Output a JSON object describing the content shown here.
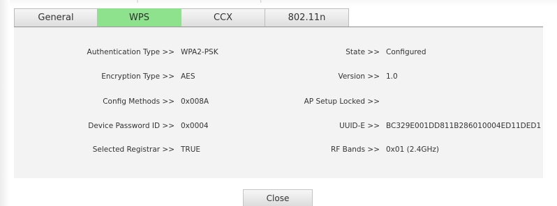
{
  "header_partial": "(",
  "header_partial2": ")",
  "tabs": [
    {
      "label": "General",
      "active": false
    },
    {
      "label": "WPS",
      "active": true
    },
    {
      "label": "CCX",
      "active": false
    },
    {
      "label": "802.11n",
      "active": false
    }
  ],
  "left_fields": [
    {
      "label": "Authentication Type >>",
      "value": "WPA2-PSK"
    },
    {
      "label": "Encryption Type >>",
      "value": "AES"
    },
    {
      "label": "Config Methods >>",
      "value": "0x008A"
    },
    {
      "label": "Device Password ID >>",
      "value": "0x0004"
    },
    {
      "label": "Selected Registrar >>",
      "value": "TRUE"
    }
  ],
  "right_fields": [
    {
      "label": "State >>",
      "value": "Configured"
    },
    {
      "label": "Version >>",
      "value": "1.0"
    },
    {
      "label": "AP Setup Locked >>",
      "value": ""
    },
    {
      "label": "UUID-E >>",
      "value": "BC329E001DD811B286010004ED11DED1"
    },
    {
      "label": "RF Bands >>",
      "value": "0x01 (2.4GHz)"
    }
  ],
  "close_label": "Close",
  "colors": {
    "active_tab": "#8ee28e",
    "panel": "#f3f3f3"
  }
}
